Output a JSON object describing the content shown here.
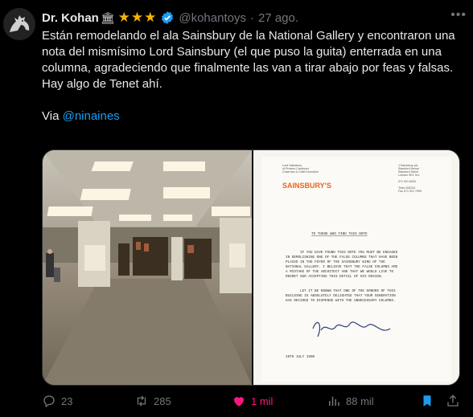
{
  "author": {
    "name": "Dr. Kohan",
    "name_emoji": "🏛",
    "stars": "★★★",
    "handle": "@kohantoys",
    "separator": "·",
    "time": "27 ago."
  },
  "tweet": {
    "text_line1": "Están remodelando el ala Sainsbury de la National Gallery y encontraron una nota del mismísimo Lord Sainsbury (el que puso la guita) enterrada en una columna, agradeciendo que finalmente las van a tirar abajo por feas y falsas.",
    "text_line2": "Hay algo de Tenet ahí.",
    "via_label": "Via",
    "via_mention": "@ninaines"
  },
  "note": {
    "brand": "SAINSBURY'S",
    "sender_lines": [
      "Lord Sainsbury",
      "of Preston Candover",
      "Chairman & Chief Executive"
    ],
    "address_lines": [
      "J Sainsbury plc",
      "Stamford House",
      "Stamford Street",
      "London SE1 9LL",
      "",
      "071 921 6000",
      "",
      "Telex 264241",
      "Fax 071 921 7990"
    ],
    "salutation": "TO THOSE WHO FIND THIS NOTE",
    "paragraph1": [
      "IF YOU HAVE FOUND THIS NOTE YOU MUST BE ENGAGED",
      "IN DEMOLISHING ONE OF THE FALSE COLUMNS THAT HAVE BEEN",
      "PLACED IN THE FOYER OF THE SAINSBURY WING OF THE",
      "NATIONAL GALLERY.  I BELIEVE THAT THE FALSE COLUMNS ARE",
      "A MISTAKE OF THE ARCHITECT AND THAT WE WOULD LIVE TO",
      "REGRET OUR ACCEPTING THIS DETAIL OF HIS DESIGN."
    ],
    "paragraph2": [
      "LET IT BE KNOWN THAT ONE OF THE DONORS OF THIS",
      "BUILDING IS ABSOLUTELY DELIGHTED THAT YOUR GENERATION",
      "HAS DECIDED TO DISPENSE WITH THE UNNECESSARY COLUMNS."
    ],
    "signature": "Dr Sainsbury",
    "date": "20TH JULY 1990"
  },
  "actions": {
    "replies": "23",
    "retweets": "285",
    "likes": "1 mil",
    "views": "88 mil"
  },
  "colors": {
    "background": "#000000",
    "text": "#e7e9ea",
    "muted": "#71767b",
    "accent": "#1d9bf0",
    "like": "#f91880",
    "star": "#f4b400",
    "brand_orange": "#e8641e"
  },
  "icons": [
    "avatar-horse",
    "verified-badge",
    "more-icon",
    "reply-icon",
    "retweet-icon",
    "like-icon",
    "views-icon",
    "bookmark-icon",
    "share-icon"
  ]
}
